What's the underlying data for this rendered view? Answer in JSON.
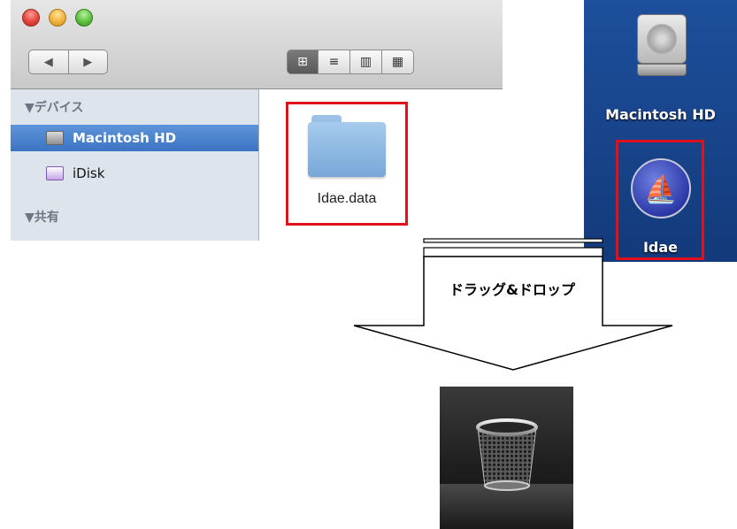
{
  "finder": {
    "nav": {
      "back_icon": "◀",
      "forward_icon": "▶"
    },
    "view_buttons": [
      {
        "name": "icon-view",
        "glyph": "⊞"
      },
      {
        "name": "list-view",
        "glyph": "≡"
      },
      {
        "name": "column-view",
        "glyph": "▥"
      },
      {
        "name": "coverflow-view",
        "glyph": "▦"
      }
    ],
    "sidebar": {
      "devices_header": "▼デバイス",
      "items": [
        {
          "label": "Macintosh HD",
          "icon": "hard-drive-icon",
          "selected": true
        },
        {
          "label": "iDisk",
          "icon": "idisk-icon",
          "selected": false
        }
      ],
      "shared_header": "▼共有"
    },
    "content": {
      "folder_label": "Idae.data"
    }
  },
  "desktop": {
    "hd_label": "Macintosh HD",
    "app_label": "Idae"
  },
  "instruction": {
    "text": "ドラッグ&ドロップ"
  },
  "colors": {
    "highlight": "#e0101e",
    "desktop_bg": "#1d4f9c",
    "selection": "#3c74c4"
  }
}
